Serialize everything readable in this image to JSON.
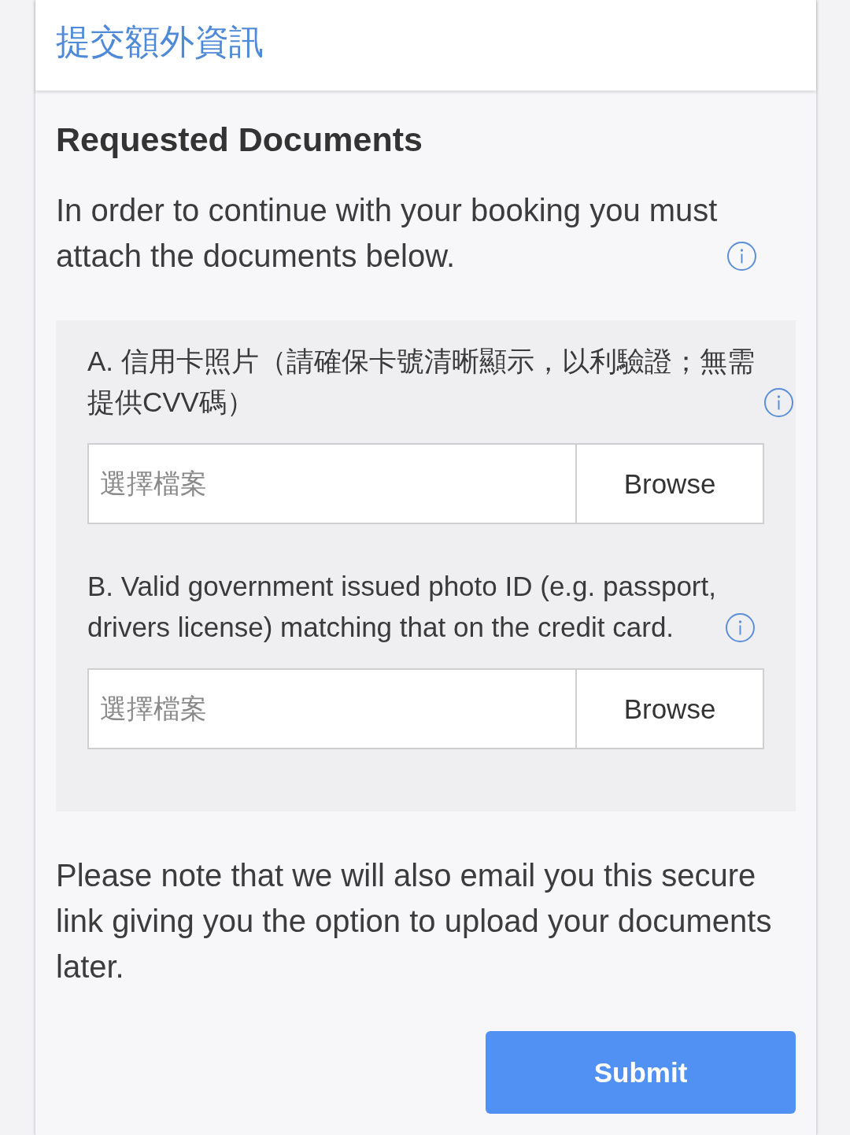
{
  "header": {
    "title": "提交額外資訊"
  },
  "section": {
    "heading": "Requested Documents",
    "intro": "In order to continue with your booking you must attach the documents below."
  },
  "documents": [
    {
      "label": "A. 信用卡照片（請確保卡號清晰顯示，以利驗證；無需提供CVV碼）",
      "placeholder": "選擇檔案",
      "button": "Browse"
    },
    {
      "label": "B. Valid government issued photo ID (e.g. passport, drivers license) matching that on the credit card.",
      "placeholder": "選擇檔案",
      "button": "Browse"
    }
  ],
  "note": "Please note that we will also email you this secure link giving you the option to upload your documents later.",
  "submit": {
    "label": "Submit"
  }
}
